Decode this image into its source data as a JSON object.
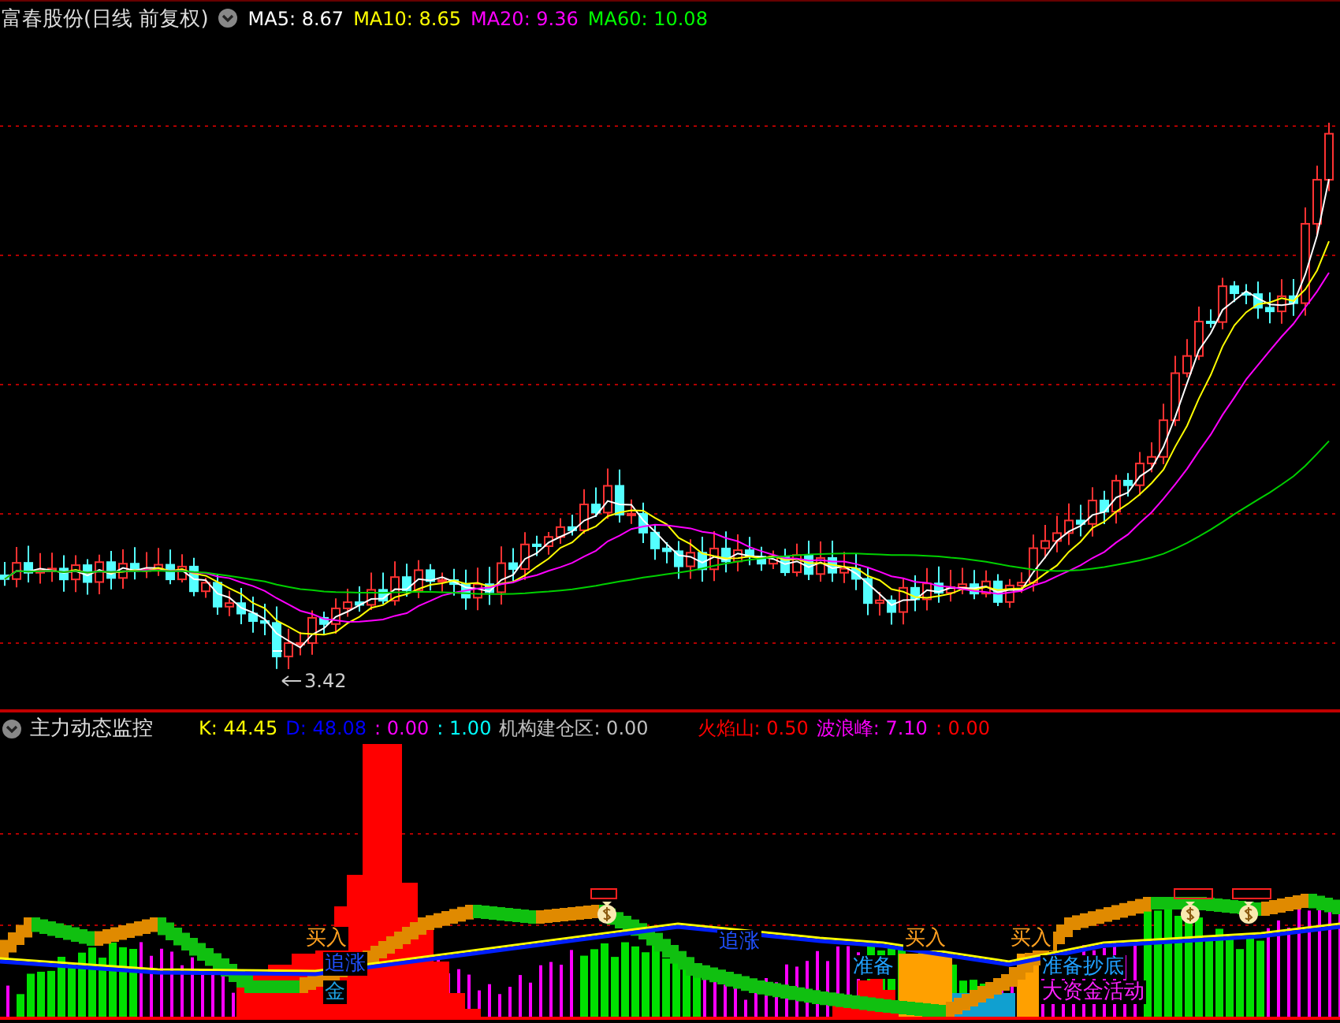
{
  "header": {
    "title": "富春股份(日线 前复权)",
    "indicators": [
      {
        "label": "MA5: 8.67",
        "color": "#ffffff"
      },
      {
        "label": "MA10: 8.65",
        "color": "#ffff00"
      },
      {
        "label": "MA20: 9.36",
        "color": "#ff00ff"
      },
      {
        "label": "MA60: 10.08",
        "color": "#00ff00"
      }
    ]
  },
  "price_chart": {
    "low_label": "3.42"
  },
  "indicator_panel": {
    "title": "主力动态监控",
    "values": [
      {
        "label": "K: 44.45",
        "color": "#ffff00"
      },
      {
        "label": "D: 48.08",
        "color": "#0000ff"
      },
      {
        "label": ": 0.00",
        "color": "#ff00ff"
      },
      {
        "label": ": 1.00",
        "color": "#00ffff"
      },
      {
        "label": "机构建仓区: 0.00",
        "color": "#c0c0c0"
      },
      {
        "label": "火焰山: 0.50",
        "color": "#ff0000"
      },
      {
        "label": "波浪峰: 7.10",
        "color": "#ff00ff"
      },
      {
        "label": ": 0.00",
        "color": "#ff0000"
      }
    ],
    "signals": [
      {
        "text": "买入",
        "kind": "buy"
      },
      {
        "text": "追涨",
        "kind": "chase"
      },
      {
        "text": "买入",
        "kind": "buy"
      },
      {
        "text": "买入",
        "kind": "buy"
      },
      {
        "text": "追涨",
        "kind": "chase"
      },
      {
        "text": "准备",
        "kind": "bottom"
      },
      {
        "text": "准备抄底",
        "kind": "bottom"
      },
      {
        "text": "金",
        "kind": "fund"
      },
      {
        "text": "大资金活动",
        "kind": "flow"
      }
    ]
  }
}
